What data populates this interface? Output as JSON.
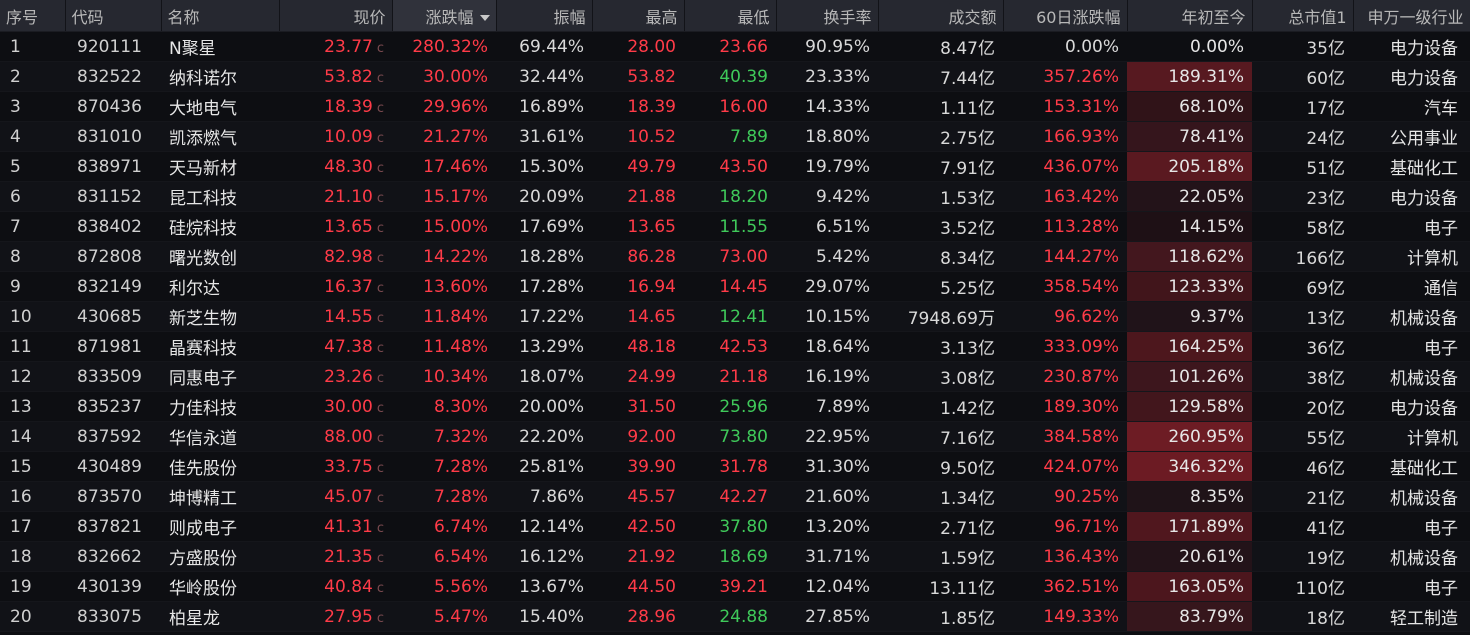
{
  "columns": [
    "序号",
    "代码",
    "名称",
    "现价",
    "涨跌幅",
    "振幅",
    "最高",
    "最低",
    "换手率",
    "成交额",
    "60日涨跌幅",
    "年初至今",
    "总市值1",
    "申万一级行业"
  ],
  "colors": {
    "up": "#ff3b48",
    "down": "#3fc95a",
    "flat": "#d9d9d9",
    "ytd_heat": "#7b1e26"
  },
  "rows": [
    {
      "seq": "1",
      "code": "920111",
      "name": "N聚星",
      "price": "23.77",
      "c": "c",
      "chg": "280.32%",
      "amp": "69.44%",
      "high": "28.00",
      "low": "23.66",
      "low_dir": "up",
      "turnover": "90.95%",
      "volume": "8.47亿",
      "d60": "0.00%",
      "d60_dir": "flat",
      "ytd": "0.00%",
      "ytd_heat": 0,
      "mcap": "35亿",
      "industry": "电力设备"
    },
    {
      "seq": "2",
      "code": "832522",
      "name": "纳科诺尔",
      "price": "53.82",
      "c": "c",
      "chg": "30.00%",
      "amp": "32.44%",
      "high": "53.82",
      "low": "40.39",
      "low_dir": "down",
      "turnover": "23.33%",
      "volume": "7.44亿",
      "d60": "357.26%",
      "d60_dir": "up",
      "ytd": "189.31%",
      "ytd_heat": 0.73,
      "mcap": "60亿",
      "industry": "电力设备"
    },
    {
      "seq": "3",
      "code": "870436",
      "name": "大地电气",
      "price": "18.39",
      "c": "c",
      "chg": "29.96%",
      "amp": "16.89%",
      "high": "18.39",
      "low": "16.00",
      "low_dir": "up",
      "turnover": "14.33%",
      "volume": "1.11亿",
      "d60": "153.31%",
      "d60_dir": "up",
      "ytd": "68.10%",
      "ytd_heat": 0.26,
      "mcap": "17亿",
      "industry": "汽车"
    },
    {
      "seq": "4",
      "code": "831010",
      "name": "凯添燃气",
      "price": "10.09",
      "c": "c",
      "chg": "21.27%",
      "amp": "31.61%",
      "high": "10.52",
      "low": "7.89",
      "low_dir": "down",
      "turnover": "18.80%",
      "volume": "2.75亿",
      "d60": "166.93%",
      "d60_dir": "up",
      "ytd": "78.41%",
      "ytd_heat": 0.3,
      "mcap": "24亿",
      "industry": "公用事业"
    },
    {
      "seq": "5",
      "code": "838971",
      "name": "天马新材",
      "price": "48.30",
      "c": "c",
      "chg": "17.46%",
      "amp": "15.30%",
      "high": "49.79",
      "low": "43.50",
      "low_dir": "up",
      "turnover": "19.79%",
      "volume": "7.91亿",
      "d60": "436.07%",
      "d60_dir": "up",
      "ytd": "205.18%",
      "ytd_heat": 0.79,
      "mcap": "51亿",
      "industry": "基础化工"
    },
    {
      "seq": "6",
      "code": "831152",
      "name": "昆工科技",
      "price": "21.10",
      "c": "c",
      "chg": "15.17%",
      "amp": "20.09%",
      "high": "21.88",
      "low": "18.20",
      "low_dir": "down",
      "turnover": "9.42%",
      "volume": "1.53亿",
      "d60": "163.42%",
      "d60_dir": "up",
      "ytd": "22.05%",
      "ytd_heat": 0.08,
      "mcap": "23亿",
      "industry": "电力设备"
    },
    {
      "seq": "7",
      "code": "838402",
      "name": "硅烷科技",
      "price": "13.65",
      "c": "c",
      "chg": "15.00%",
      "amp": "17.69%",
      "high": "13.65",
      "low": "11.55",
      "low_dir": "down",
      "turnover": "6.51%",
      "volume": "3.52亿",
      "d60": "113.28%",
      "d60_dir": "up",
      "ytd": "14.15%",
      "ytd_heat": 0.05,
      "mcap": "58亿",
      "industry": "电子"
    },
    {
      "seq": "8",
      "code": "872808",
      "name": "曙光数创",
      "price": "82.98",
      "c": "c",
      "chg": "14.22%",
      "amp": "18.28%",
      "high": "86.28",
      "low": "73.00",
      "low_dir": "up",
      "turnover": "5.42%",
      "volume": "8.34亿",
      "d60": "144.27%",
      "d60_dir": "up",
      "ytd": "118.62%",
      "ytd_heat": 0.46,
      "mcap": "166亿",
      "industry": "计算机"
    },
    {
      "seq": "9",
      "code": "832149",
      "name": "利尔达",
      "price": "16.37",
      "c": "c",
      "chg": "13.60%",
      "amp": "17.28%",
      "high": "16.94",
      "low": "14.45",
      "low_dir": "up",
      "turnover": "29.07%",
      "volume": "5.25亿",
      "d60": "358.54%",
      "d60_dir": "up",
      "ytd": "123.33%",
      "ytd_heat": 0.48,
      "mcap": "69亿",
      "industry": "通信"
    },
    {
      "seq": "10",
      "code": "430685",
      "name": "新芝生物",
      "price": "14.55",
      "c": "c",
      "chg": "11.84%",
      "amp": "17.22%",
      "high": "14.65",
      "low": "12.41",
      "low_dir": "down",
      "turnover": "10.15%",
      "volume": "7948.69万",
      "d60": "96.62%",
      "d60_dir": "up",
      "ytd": "9.37%",
      "ytd_heat": 0.04,
      "mcap": "13亿",
      "industry": "机械设备"
    },
    {
      "seq": "11",
      "code": "871981",
      "name": "晶赛科技",
      "price": "47.38",
      "c": "c",
      "chg": "11.48%",
      "amp": "13.29%",
      "high": "48.18",
      "low": "42.53",
      "low_dir": "up",
      "turnover": "18.64%",
      "volume": "3.13亿",
      "d60": "333.09%",
      "d60_dir": "up",
      "ytd": "164.25%",
      "ytd_heat": 0.63,
      "mcap": "36亿",
      "industry": "电子"
    },
    {
      "seq": "12",
      "code": "833509",
      "name": "同惠电子",
      "price": "23.26",
      "c": "c",
      "chg": "10.34%",
      "amp": "18.07%",
      "high": "24.99",
      "low": "21.18",
      "low_dir": "up",
      "turnover": "16.19%",
      "volume": "3.08亿",
      "d60": "230.87%",
      "d60_dir": "up",
      "ytd": "101.26%",
      "ytd_heat": 0.39,
      "mcap": "38亿",
      "industry": "机械设备"
    },
    {
      "seq": "13",
      "code": "835237",
      "name": "力佳科技",
      "price": "30.00",
      "c": "c",
      "chg": "8.30%",
      "amp": "20.00%",
      "high": "31.50",
      "low": "25.96",
      "low_dir": "down",
      "turnover": "7.89%",
      "volume": "1.42亿",
      "d60": "189.30%",
      "d60_dir": "up",
      "ytd": "129.58%",
      "ytd_heat": 0.5,
      "mcap": "20亿",
      "industry": "电力设备"
    },
    {
      "seq": "14",
      "code": "837592",
      "name": "华信永道",
      "price": "88.00",
      "c": "c",
      "chg": "7.32%",
      "amp": "22.20%",
      "high": "92.00",
      "low": "73.80",
      "low_dir": "down",
      "turnover": "22.95%",
      "volume": "7.16亿",
      "d60": "384.58%",
      "d60_dir": "up",
      "ytd": "260.95%",
      "ytd_heat": 1.0,
      "mcap": "55亿",
      "industry": "计算机"
    },
    {
      "seq": "15",
      "code": "430489",
      "name": "佳先股份",
      "price": "33.75",
      "c": "c",
      "chg": "7.28%",
      "amp": "25.81%",
      "high": "39.90",
      "low": "31.78",
      "low_dir": "up",
      "turnover": "31.30%",
      "volume": "9.50亿",
      "d60": "424.07%",
      "d60_dir": "up",
      "ytd": "346.32%",
      "ytd_heat": 1.0,
      "mcap": "46亿",
      "industry": "基础化工"
    },
    {
      "seq": "16",
      "code": "873570",
      "name": "坤博精工",
      "price": "45.07",
      "c": "c",
      "chg": "7.28%",
      "amp": "7.86%",
      "high": "45.57",
      "low": "42.27",
      "low_dir": "up",
      "turnover": "21.60%",
      "volume": "1.34亿",
      "d60": "90.25%",
      "d60_dir": "up",
      "ytd": "8.35%",
      "ytd_heat": 0.03,
      "mcap": "21亿",
      "industry": "机械设备"
    },
    {
      "seq": "17",
      "code": "837821",
      "name": "则成电子",
      "price": "41.31",
      "c": "c",
      "chg": "6.74%",
      "amp": "12.14%",
      "high": "42.50",
      "low": "37.80",
      "low_dir": "down",
      "turnover": "13.20%",
      "volume": "2.71亿",
      "d60": "96.71%",
      "d60_dir": "up",
      "ytd": "171.89%",
      "ytd_heat": 0.66,
      "mcap": "41亿",
      "industry": "电子"
    },
    {
      "seq": "18",
      "code": "832662",
      "name": "方盛股份",
      "price": "21.35",
      "c": "c",
      "chg": "6.54%",
      "amp": "16.12%",
      "high": "21.92",
      "low": "18.69",
      "low_dir": "down",
      "turnover": "31.71%",
      "volume": "1.59亿",
      "d60": "136.43%",
      "d60_dir": "up",
      "ytd": "20.61%",
      "ytd_heat": 0.08,
      "mcap": "19亿",
      "industry": "机械设备"
    },
    {
      "seq": "19",
      "code": "430139",
      "name": "华岭股份",
      "price": "40.84",
      "c": "c",
      "chg": "5.56%",
      "amp": "13.67%",
      "high": "44.50",
      "low": "39.21",
      "low_dir": "up",
      "turnover": "12.04%",
      "volume": "13.11亿",
      "d60": "362.51%",
      "d60_dir": "up",
      "ytd": "163.05%",
      "ytd_heat": 0.62,
      "mcap": "110亿",
      "industry": "电子"
    },
    {
      "seq": "20",
      "code": "833075",
      "name": "柏星龙",
      "price": "27.95",
      "c": "c",
      "chg": "5.47%",
      "amp": "15.40%",
      "high": "28.96",
      "low": "24.88",
      "low_dir": "down",
      "turnover": "27.85%",
      "volume": "1.85亿",
      "d60": "149.33%",
      "d60_dir": "up",
      "ytd": "83.79%",
      "ytd_heat": 0.32,
      "mcap": "18亿",
      "industry": "轻工制造"
    }
  ]
}
